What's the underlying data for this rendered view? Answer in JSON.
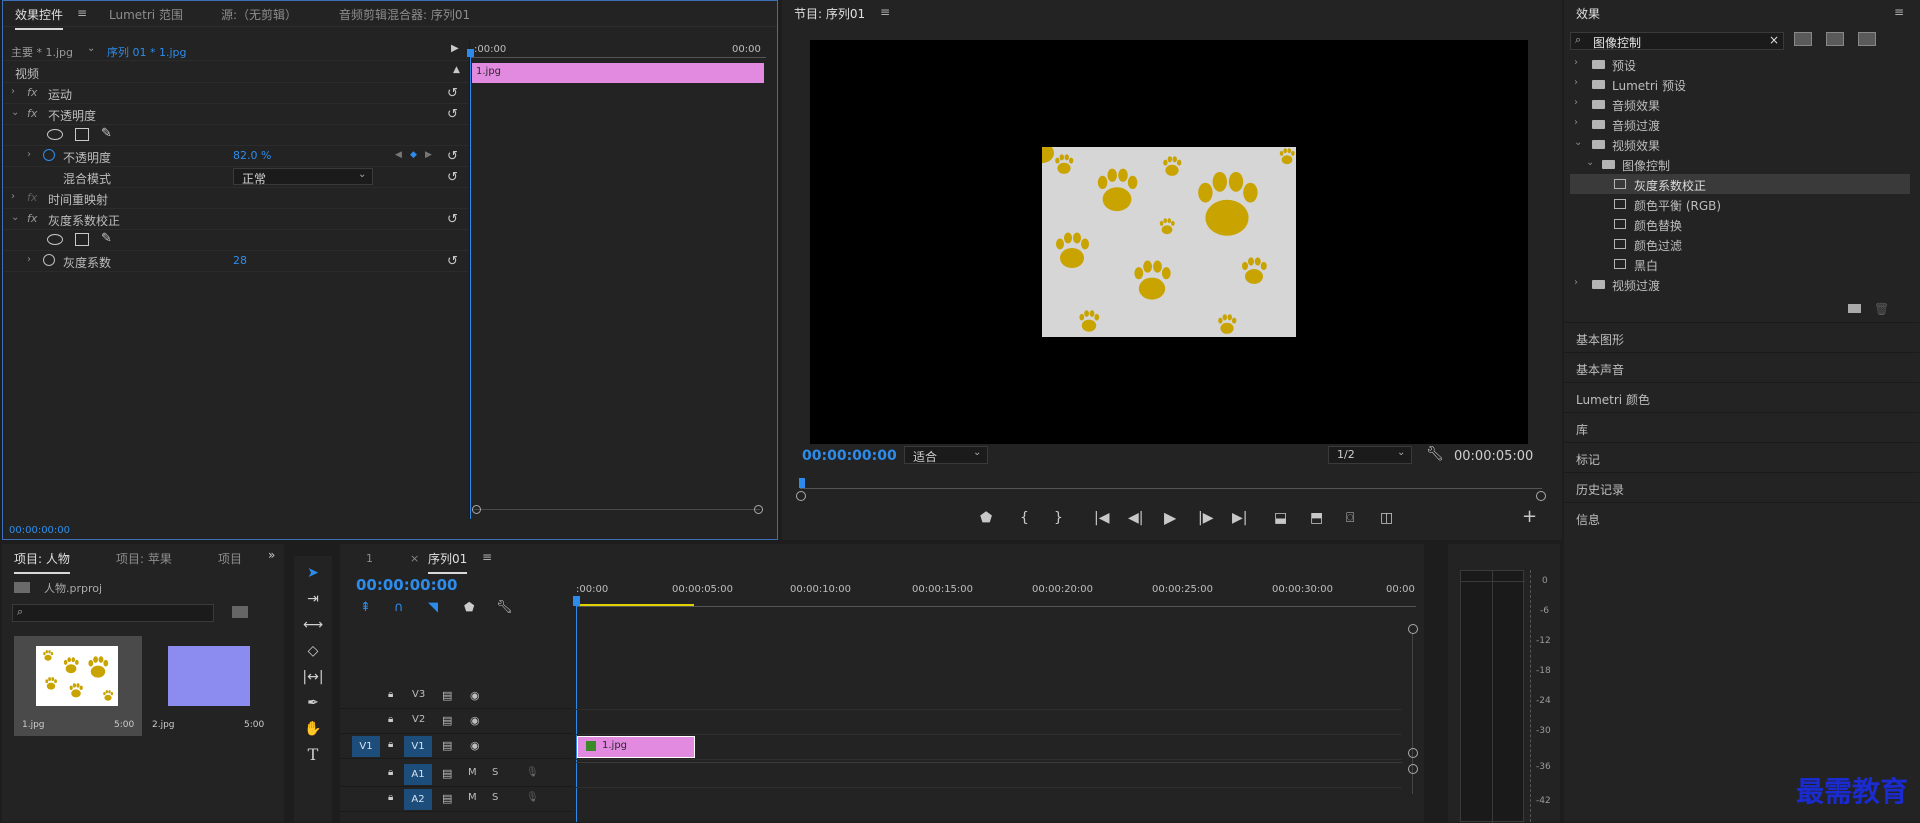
{
  "effect_controls": {
    "tabs": [
      "效果控件",
      "Lumetri 范围",
      "源:（无剪辑）",
      "音频剪辑混合器: 序列01"
    ],
    "master_clip": "主要 * 1.jpg",
    "sequence_clip": "序列 01 * 1.jpg",
    "ruler_start": ":00:00",
    "ruler_end": "00:00",
    "clip_name": "1.jpg",
    "section_video": "视频",
    "motion": "运动",
    "opacity": "不透明度",
    "opacity_param": "不透明度",
    "opacity_value": "82.0 %",
    "blend_mode_label": "混合模式",
    "blend_mode_value": "正常",
    "time_remap": "时间重映射",
    "gamma_effect": "灰度系数校正",
    "gamma_param": "灰度系数",
    "gamma_value": "28",
    "timecode": "00:00:00:00",
    "fx_label": "fx"
  },
  "program_monitor": {
    "title": "节目: 序列01",
    "timecode": "00:00:00:00",
    "fit": "适合",
    "resolution": "1/2",
    "duration": "00:00:05:00"
  },
  "project": {
    "tabs": [
      "项目: 人物",
      "项目: 苹果",
      "项目"
    ],
    "project_file": "人物.prproj",
    "items": [
      {
        "name": "1.jpg",
        "duration": "5:00"
      },
      {
        "name": "2.jpg",
        "duration": "5:00"
      }
    ]
  },
  "timeline": {
    "tab_other": "1",
    "tab_active": "序列01",
    "timecode": "00:00:00:00",
    "ruler_labels": [
      ":00:00",
      "00:00:05:00",
      "00:00:10:00",
      "00:00:15:00",
      "00:00:20:00",
      "00:00:25:00",
      "00:00:30:00",
      "00:00"
    ],
    "clip_name": "1.jpg",
    "tracks": [
      "V3",
      "V2",
      "V1",
      "A1",
      "A2"
    ],
    "source_patch_v": "V1",
    "mute": "M",
    "solo": "S"
  },
  "meter": {
    "labels": [
      "0",
      "-6",
      "-12",
      "-18",
      "-24",
      "-30",
      "-36",
      "-42"
    ]
  },
  "effects_panel": {
    "title": "效果",
    "search_value": "图像控制",
    "tree": [
      {
        "label": "预设",
        "level": 0,
        "kind": "folder",
        "expanded": false
      },
      {
        "label": "Lumetri 预设",
        "level": 0,
        "kind": "folder",
        "expanded": false
      },
      {
        "label": "音频效果",
        "level": 0,
        "kind": "folder",
        "expanded": false
      },
      {
        "label": "音频过渡",
        "level": 0,
        "kind": "folder",
        "expanded": false
      },
      {
        "label": "视频效果",
        "level": 0,
        "kind": "folder",
        "expanded": true
      },
      {
        "label": "图像控制",
        "level": 1,
        "kind": "folder",
        "expanded": true
      },
      {
        "label": "灰度系数校正",
        "level": 2,
        "kind": "effect",
        "selected": true
      },
      {
        "label": "颜色平衡 (RGB)",
        "level": 2,
        "kind": "effect"
      },
      {
        "label": "颜色替换",
        "level": 2,
        "kind": "effect"
      },
      {
        "label": "颜色过滤",
        "level": 2,
        "kind": "effect"
      },
      {
        "label": "黑白",
        "level": 2,
        "kind": "effect"
      },
      {
        "label": "视频过渡",
        "level": 0,
        "kind": "folder",
        "expanded": false
      }
    ],
    "sections": [
      "基本图形",
      "基本声音",
      "Lumetri 颜色",
      "库",
      "标记",
      "历史记录",
      "信息"
    ]
  },
  "watermark": "最需教育",
  "colors": {
    "accent_blue": "#2d8ceb",
    "clip_pink": "#e28ae0",
    "paw_yellow": "#c9a300",
    "lavender": "#8c8cf0"
  }
}
